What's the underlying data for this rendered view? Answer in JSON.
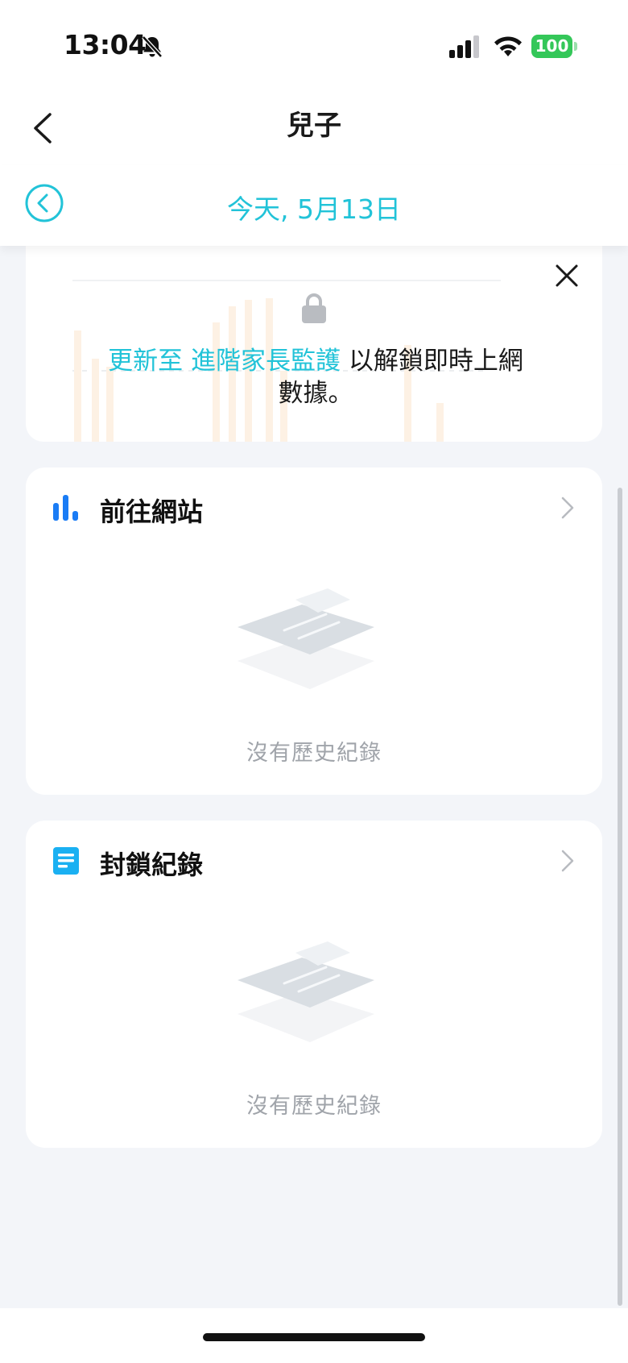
{
  "status_bar": {
    "time": "13:04",
    "icons": [
      "bell-slash-icon",
      "cellular-signal-icon",
      "wifi-icon",
      "battery-icon"
    ],
    "battery_level": "100",
    "battery_color": "#34c759"
  },
  "nav": {
    "title": "兒子",
    "back_icon": "chevron-left-icon"
  },
  "date_bar": {
    "label": "今天, 5月13日",
    "prev_icon": "circle-chevron-left-icon",
    "accent_color": "#22c3d8"
  },
  "locked_chart": {
    "lock_icon": "lock-icon",
    "close_icon": "close-icon",
    "message_link": "更新至 進階家長監護",
    "message_text": " 以解鎖即時上網數據。"
  },
  "websites_card": {
    "title": "前往網站",
    "icon": "bar-chart-icon",
    "chevron_icon": "chevron-right-icon",
    "empty_text": "沒有歷史紀錄"
  },
  "blocked_card": {
    "title": "封鎖紀錄",
    "icon": "document-list-icon",
    "chevron_icon": "chevron-right-icon",
    "empty_text": "沒有歷史紀錄"
  }
}
